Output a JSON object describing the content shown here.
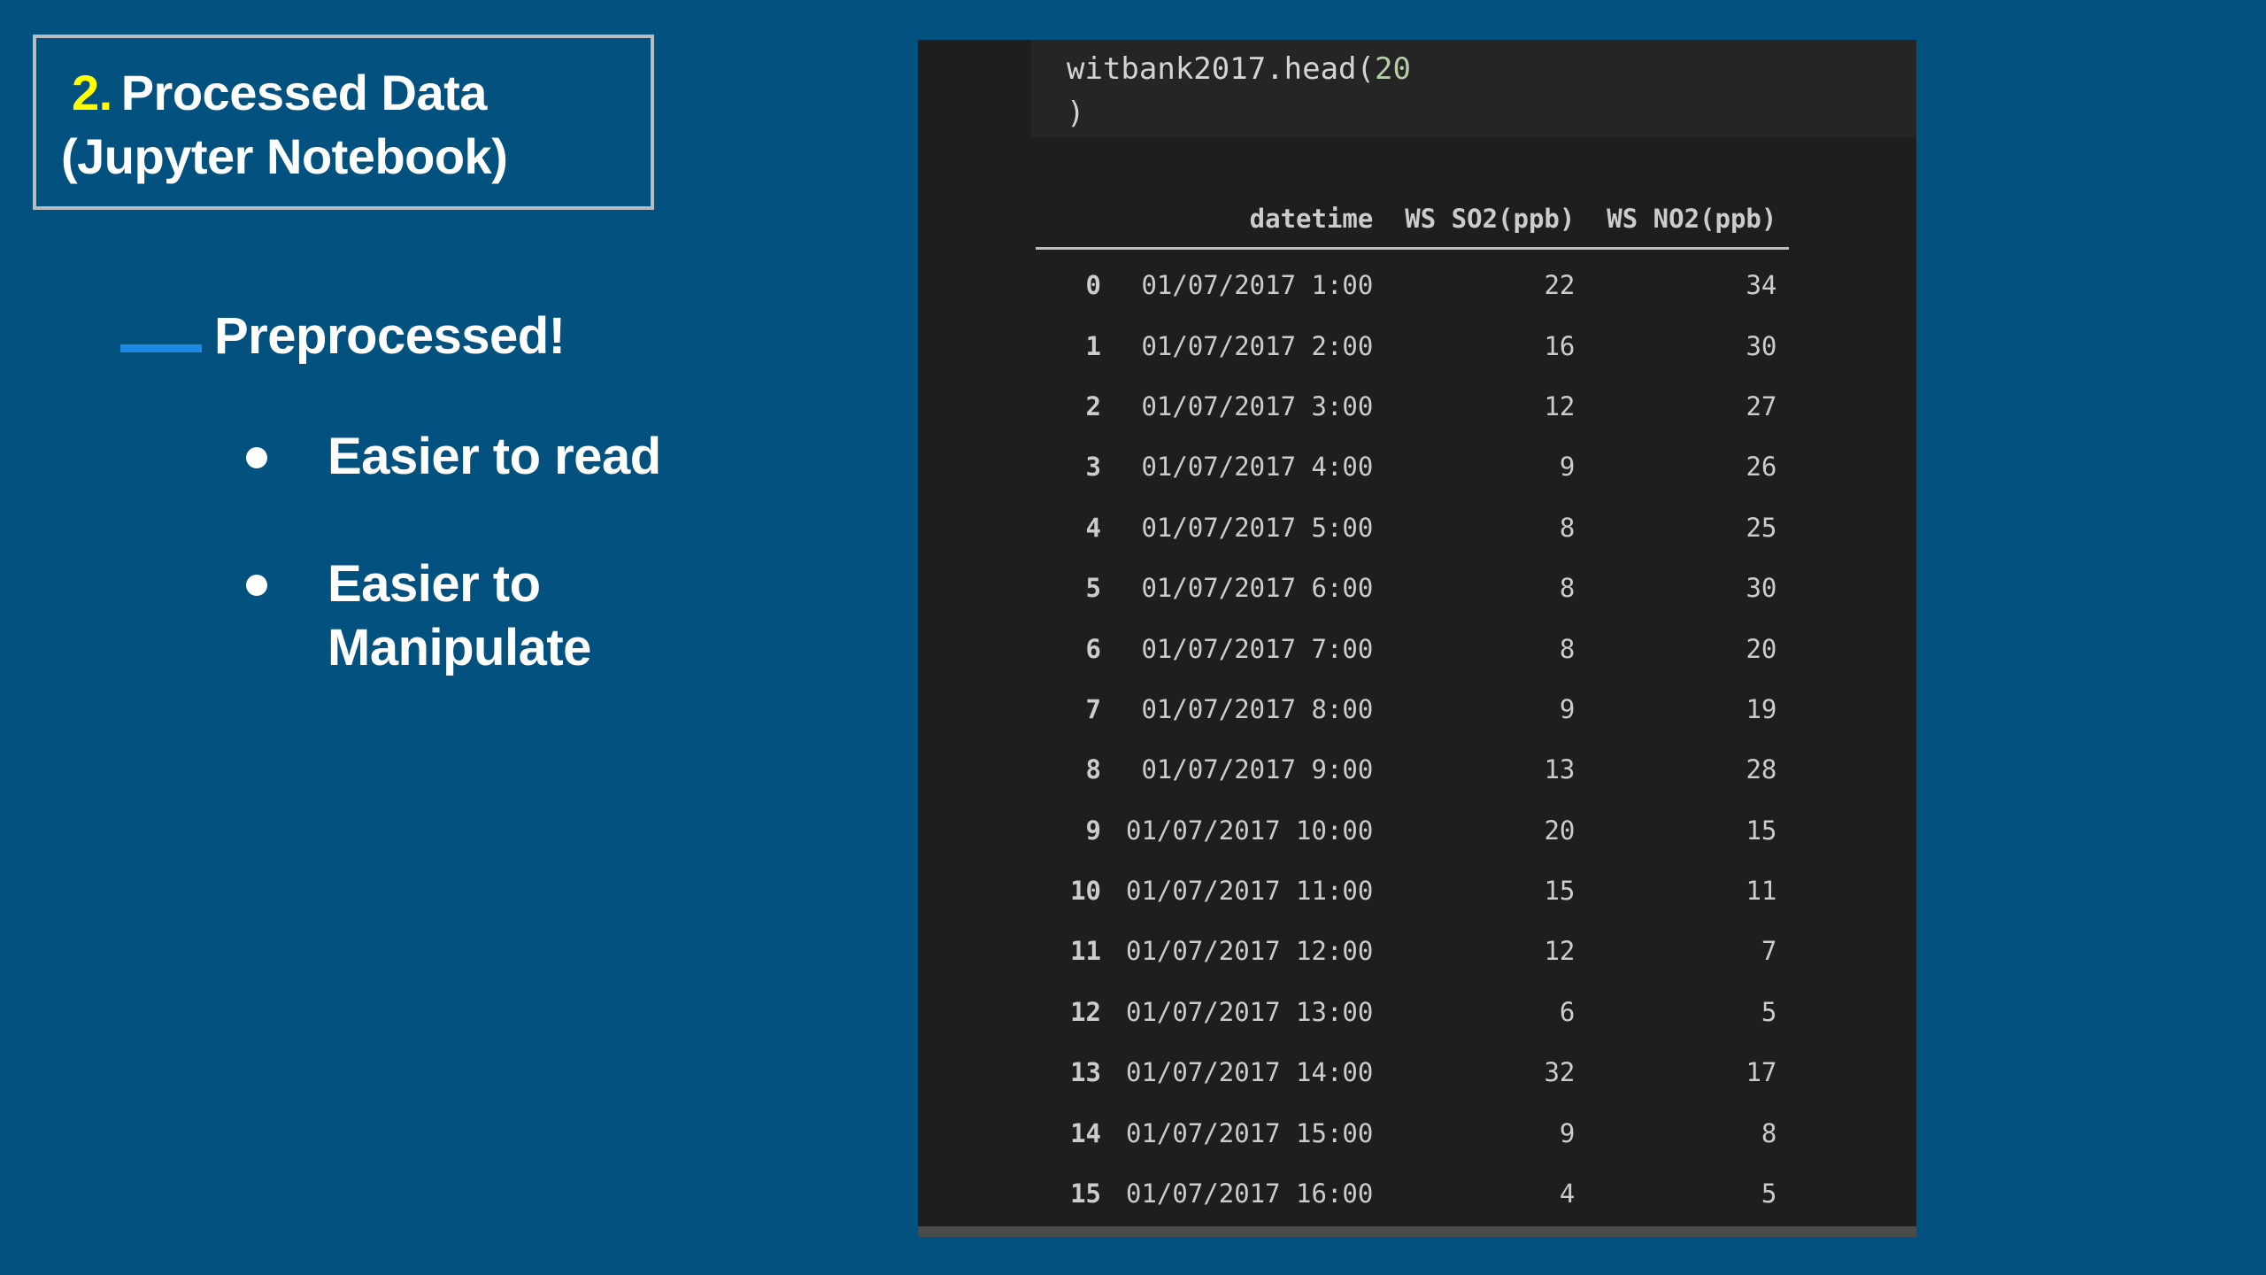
{
  "title": {
    "number": "2.",
    "line1": "Processed Data",
    "line2": "(Jupyter Notebook)"
  },
  "subheading": "Preprocessed!",
  "bullets": [
    {
      "text": "Easier to read"
    },
    {
      "text": "Easier to\nManipulate"
    }
  ],
  "code": {
    "prefix": "witbank2017.head(",
    "arg": "20",
    "suffix": ")"
  },
  "table": {
    "headers": [
      "",
      "datetime",
      "WS SO2(ppb)",
      "WS NO2(ppb)"
    ],
    "rows": [
      [
        "0",
        "01/07/2017 1:00",
        "22",
        "34"
      ],
      [
        "1",
        "01/07/2017 2:00",
        "16",
        "30"
      ],
      [
        "2",
        "01/07/2017 3:00",
        "12",
        "27"
      ],
      [
        "3",
        "01/07/2017 4:00",
        "9",
        "26"
      ],
      [
        "4",
        "01/07/2017 5:00",
        "8",
        "25"
      ],
      [
        "5",
        "01/07/2017 6:00",
        "8",
        "30"
      ],
      [
        "6",
        "01/07/2017 7:00",
        "8",
        "20"
      ],
      [
        "7",
        "01/07/2017 8:00",
        "9",
        "19"
      ],
      [
        "8",
        "01/07/2017 9:00",
        "13",
        "28"
      ],
      [
        "9",
        "01/07/2017 10:00",
        "20",
        "15"
      ],
      [
        "10",
        "01/07/2017 11:00",
        "15",
        "11"
      ],
      [
        "11",
        "01/07/2017 12:00",
        "12",
        "7"
      ],
      [
        "12",
        "01/07/2017 13:00",
        "6",
        "5"
      ],
      [
        "13",
        "01/07/2017 14:00",
        "32",
        "17"
      ],
      [
        "14",
        "01/07/2017 15:00",
        "9",
        "8"
      ],
      [
        "15",
        "01/07/2017 16:00",
        "4",
        "5"
      ]
    ]
  },
  "colors": {
    "background": "#02517e",
    "accent_number": "#ffff00",
    "accent_dash": "#1e88e5",
    "panel": "#1e1e1e"
  }
}
